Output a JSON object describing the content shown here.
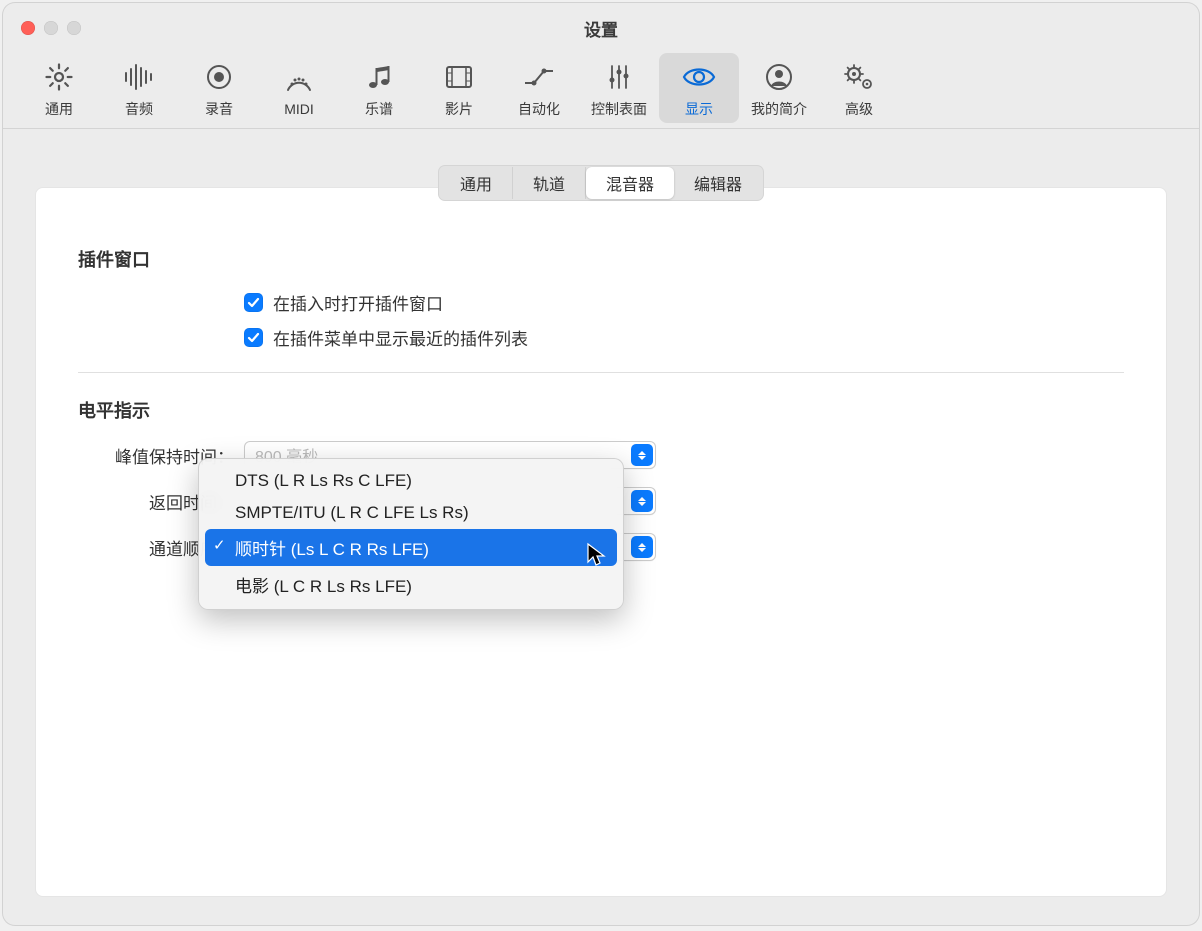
{
  "window": {
    "title": "设置"
  },
  "toolbar": {
    "items": [
      {
        "name": "general",
        "label": "通用"
      },
      {
        "name": "audio",
        "label": "音频"
      },
      {
        "name": "recording",
        "label": "录音"
      },
      {
        "name": "midi",
        "label": "MIDI"
      },
      {
        "name": "score",
        "label": "乐谱"
      },
      {
        "name": "movie",
        "label": "影片"
      },
      {
        "name": "automation",
        "label": "自动化"
      },
      {
        "name": "control-surfaces",
        "label": "控制表面"
      },
      {
        "name": "display",
        "label": "显示",
        "active": true
      },
      {
        "name": "my-info",
        "label": "我的简介"
      },
      {
        "name": "advanced",
        "label": "高级"
      }
    ]
  },
  "tabs": {
    "items": [
      {
        "name": "general",
        "label": "通用"
      },
      {
        "name": "tracks",
        "label": "轨道"
      },
      {
        "name": "mixer",
        "label": "混音器",
        "active": true
      },
      {
        "name": "editor",
        "label": "编辑器"
      }
    ]
  },
  "sections": {
    "plugin_window": {
      "title": "插件窗口",
      "checks": {
        "open_on_insert": "在插入时打开插件窗口",
        "show_recent": "在插件菜单中显示最近的插件列表"
      }
    },
    "level_meter": {
      "title": "电平指示",
      "peak_hold_label": "峰值保持时间：",
      "peak_hold_value": "800 毫秒",
      "return_time_label": "返回时间：",
      "return_time_value": "",
      "channel_order_label": "通道顺序：",
      "channel_order_value": ""
    }
  },
  "dropdown": {
    "items": [
      {
        "label": "DTS (L R Ls Rs C LFE)"
      },
      {
        "label": "SMPTE/ITU (L R C LFE Ls Rs)"
      },
      {
        "label": "顺时针 (Ls L C R Rs LFE)",
        "selected": true
      },
      {
        "label": "电影 (L C R Ls Rs LFE)"
      }
    ]
  }
}
